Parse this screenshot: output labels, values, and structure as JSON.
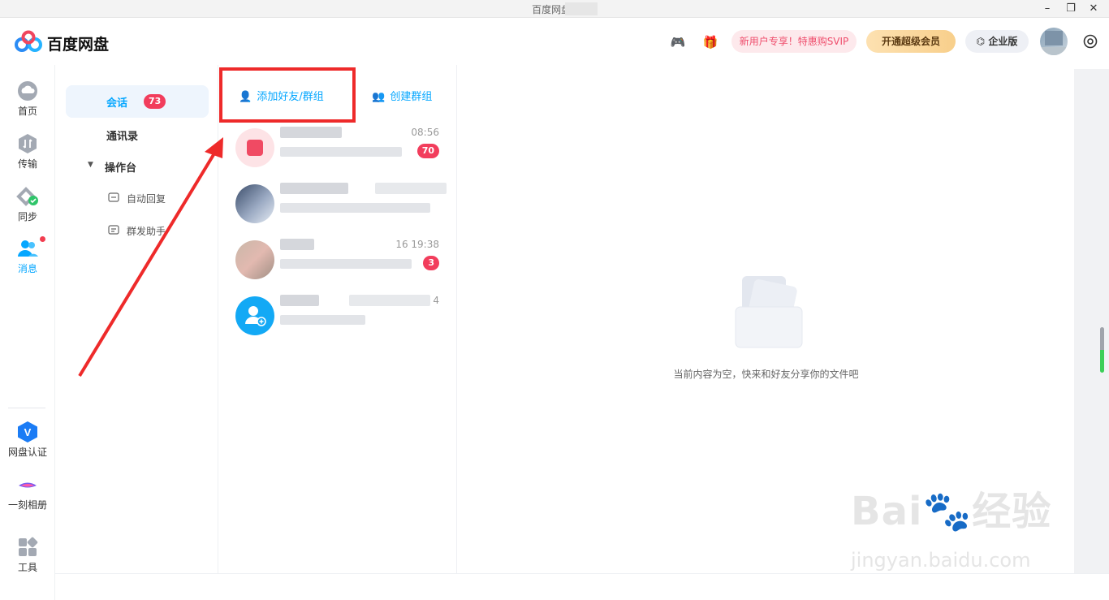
{
  "titlebar": {
    "title": "百度网盘 ·"
  },
  "header": {
    "brand": "百度网盘",
    "promo": "新用户专享！特惠购SVIP",
    "svip_button": "开通超级会员",
    "enterprise_button": "企业版"
  },
  "nav": {
    "items": [
      {
        "label": "首页",
        "icon": "cloud-icon"
      },
      {
        "label": "传输",
        "icon": "transfer-icon"
      },
      {
        "label": "同步",
        "icon": "sync-icon"
      },
      {
        "label": "消息",
        "icon": "message-icon",
        "active": true
      },
      {
        "label": "网盘认证",
        "icon": "verify-icon"
      },
      {
        "label": "一刻相册",
        "icon": "album-icon"
      },
      {
        "label": "工具",
        "icon": "tools-icon"
      }
    ]
  },
  "sidebar": {
    "session_label": "会话",
    "session_count": "73",
    "contacts_label": "通讯录",
    "console_label": "操作台",
    "auto_reply_label": "自动回复",
    "broadcast_label": "群发助手"
  },
  "chatlist": {
    "add_friend": "添加好友/群组",
    "create_group": "创建群组",
    "conversations": [
      {
        "time": "08:56",
        "unread": "70"
      },
      {
        "time": "",
        "unread": ""
      },
      {
        "time": "16 19:38",
        "unread": "3"
      },
      {
        "time": "4",
        "unread": ""
      }
    ]
  },
  "main": {
    "empty_text": "当前内容为空，快来和好友分享你的文件吧"
  },
  "watermark": {
    "line1": "Bai",
    "line1b": "经验",
    "line2": "jingyan.baidu.com"
  },
  "colors": {
    "accent": "#06a7ff",
    "badge": "#f23d5c",
    "highlight": "#ee2a2a"
  }
}
